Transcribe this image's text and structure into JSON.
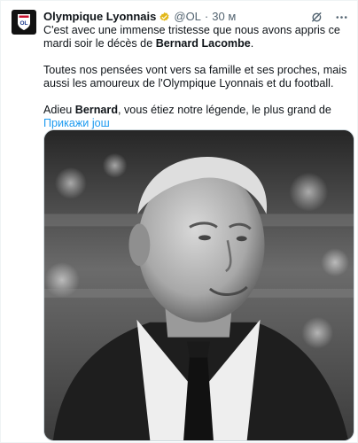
{
  "tweet": {
    "author_name": "Olympique Lyonnais",
    "handle": "@OL",
    "separator": "·",
    "time": "30 м",
    "avatar_text": "OL",
    "paragraph1_pre": "C'est avec une immense tristesse que nous avons appris ce mardi soir le décès de ",
    "paragraph1_bold": "Bernard Lacombe",
    "paragraph1_post": ".",
    "paragraph2": "Toutes nos pensées vont vers sa famille et ses proches, mais aussi les amoureux de l'Olympique Lyonnais et du football.",
    "paragraph3_pre": "Adieu ",
    "paragraph3_bold": "Bernard",
    "paragraph3_post": ", vous étiez notre légende, le plus grand de",
    "show_more": "Прикажи још"
  },
  "icons": {
    "verified": "verified-badge-icon",
    "grok": "grok-icon",
    "more": "more-options-icon"
  },
  "colors": {
    "link": "#1d9bf0",
    "verified": "#e2b719",
    "secondary_text": "#536471"
  }
}
